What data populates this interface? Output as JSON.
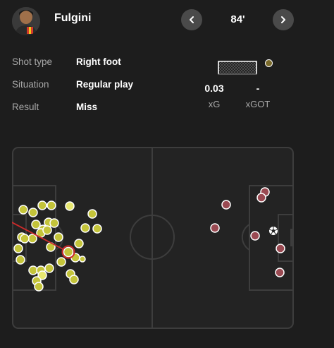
{
  "header": {
    "player_name": "Fulgini",
    "avatar_icon": "player-avatar",
    "minute": "84'",
    "prev_icon": "chevron-left-icon",
    "next_icon": "chevron-right-icon"
  },
  "shot_details": [
    {
      "label": "Shot type",
      "value": "Right foot"
    },
    {
      "label": "Situation",
      "value": "Regular play"
    },
    {
      "label": "Result",
      "value": "Miss"
    }
  ],
  "stats": {
    "xg_value": "0.03",
    "xg_label": "xG",
    "xgot_value": "-",
    "xgot_label": "xGOT"
  },
  "colors": {
    "background": "#1d1d1d",
    "pitch": "#232323",
    "pitch_lines": "#3d3d3d",
    "home_shot": "#c4c43a",
    "away_shot": "#9a4a52",
    "shot_trajectory": "#cc2a2a"
  },
  "shot_map": {
    "home_shots": 34,
    "away_shots": 9,
    "goals": 1,
    "selected_shot": "Fulgini 84' miss"
  }
}
